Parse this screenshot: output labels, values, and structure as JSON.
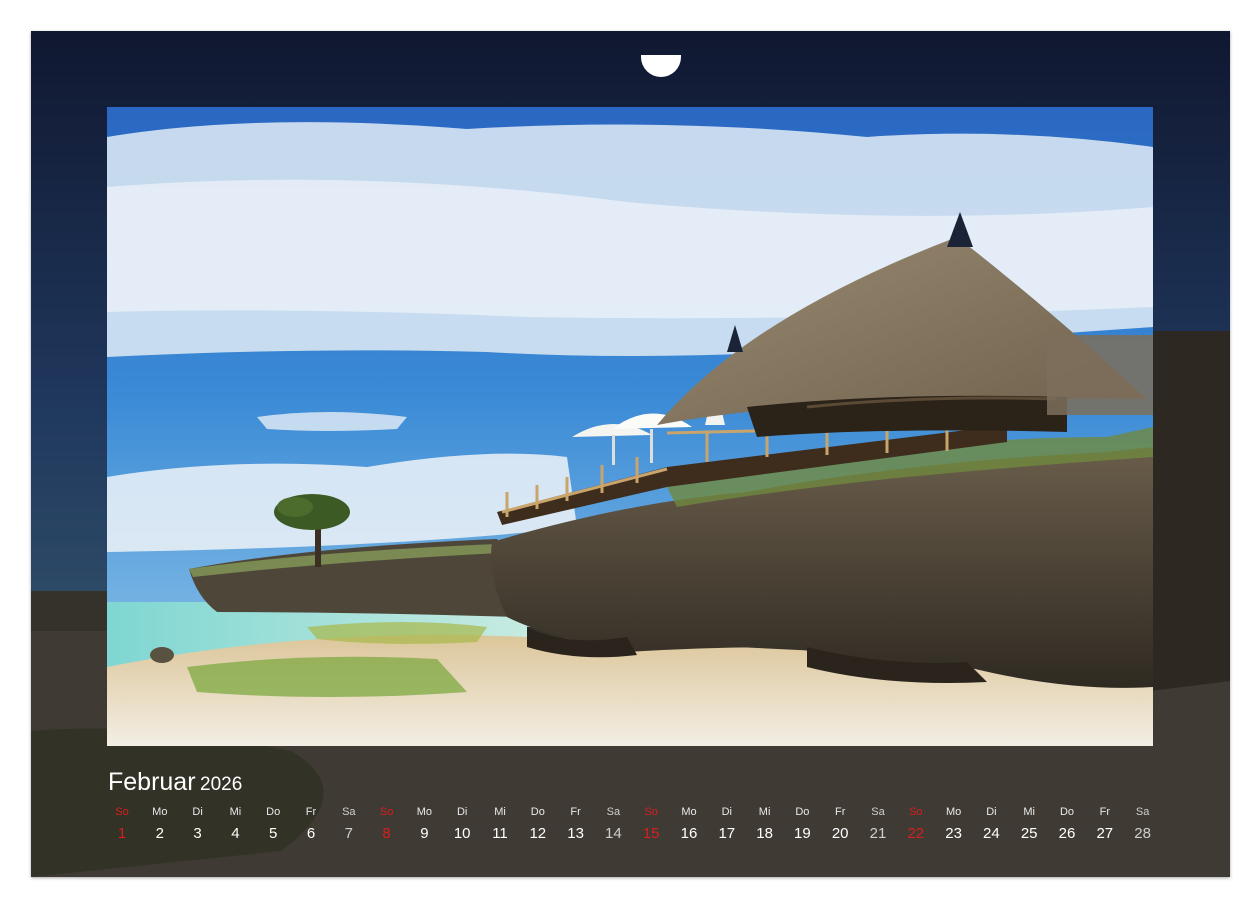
{
  "calendar": {
    "month": "Februar",
    "year": "2026",
    "days": [
      {
        "wd": "So",
        "d": "1",
        "type": "sunday"
      },
      {
        "wd": "Mo",
        "d": "2",
        "type": "weekday"
      },
      {
        "wd": "Di",
        "d": "3",
        "type": "weekday"
      },
      {
        "wd": "Mi",
        "d": "4",
        "type": "weekday"
      },
      {
        "wd": "Do",
        "d": "5",
        "type": "weekday"
      },
      {
        "wd": "Fr",
        "d": "6",
        "type": "weekday"
      },
      {
        "wd": "Sa",
        "d": "7",
        "type": "saturday"
      },
      {
        "wd": "So",
        "d": "8",
        "type": "sunday"
      },
      {
        "wd": "Mo",
        "d": "9",
        "type": "weekday"
      },
      {
        "wd": "Di",
        "d": "10",
        "type": "weekday"
      },
      {
        "wd": "Mi",
        "d": "11",
        "type": "weekday"
      },
      {
        "wd": "Do",
        "d": "12",
        "type": "weekday"
      },
      {
        "wd": "Fr",
        "d": "13",
        "type": "weekday"
      },
      {
        "wd": "Sa",
        "d": "14",
        "type": "saturday"
      },
      {
        "wd": "So",
        "d": "15",
        "type": "sunday"
      },
      {
        "wd": "Mo",
        "d": "16",
        "type": "weekday"
      },
      {
        "wd": "Di",
        "d": "17",
        "type": "weekday"
      },
      {
        "wd": "Mi",
        "d": "18",
        "type": "weekday"
      },
      {
        "wd": "Do",
        "d": "19",
        "type": "weekday"
      },
      {
        "wd": "Fr",
        "d": "20",
        "type": "weekday"
      },
      {
        "wd": "Sa",
        "d": "21",
        "type": "saturday"
      },
      {
        "wd": "So",
        "d": "22",
        "type": "sunday"
      },
      {
        "wd": "Mo",
        "d": "23",
        "type": "weekday"
      },
      {
        "wd": "Di",
        "d": "24",
        "type": "weekday"
      },
      {
        "wd": "Mi",
        "d": "25",
        "type": "weekday"
      },
      {
        "wd": "Do",
        "d": "26",
        "type": "weekday"
      },
      {
        "wd": "Fr",
        "d": "27",
        "type": "weekday"
      },
      {
        "wd": "Sa",
        "d": "28",
        "type": "saturday"
      }
    ]
  },
  "colors": {
    "sunday": "#d81e1e",
    "sky": "#2f7fd0",
    "sand": "#efe9dc",
    "rock": "#4b4338",
    "thatch": "#8c7c66",
    "frame_dark": "#14182a"
  }
}
